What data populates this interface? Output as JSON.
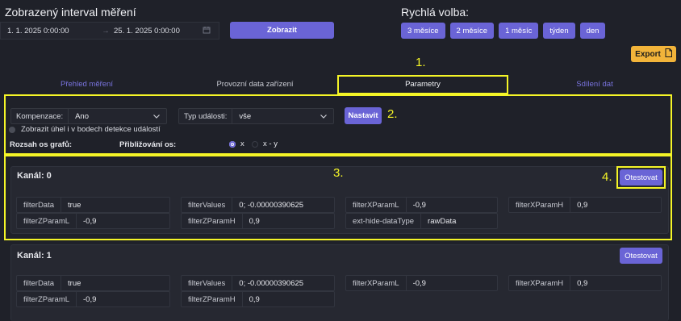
{
  "header": {
    "interval_title": "Zobrazený interval měření",
    "date_from": "1. 1. 2025 0:00:00",
    "date_to": "25. 1. 2025 0:00:00",
    "arrow": "→",
    "show_button": "Zobrazit",
    "quick_title": "Rychlá volba:",
    "quick_options": [
      "3 měsíce",
      "2 měsíce",
      "1 měsíc",
      "týden",
      "den"
    ],
    "export_button": "Export"
  },
  "annotations": {
    "n1": "1.",
    "n2": "2.",
    "n3": "3.",
    "n4": "4."
  },
  "tabs": [
    {
      "label": "Přehled měření",
      "active": false
    },
    {
      "label": "Provozní data zařízení",
      "active": false
    },
    {
      "label": "Parametry",
      "active": true
    },
    {
      "label": "Sdílení dat",
      "active": false
    }
  ],
  "filters": {
    "compensation_label": "Kompenzace:",
    "compensation_value": "Ano",
    "event_type_label": "Typ události:",
    "event_type_value": "vše",
    "set_button": "Nastavit",
    "show_angle_label": "Zobrazit úhel i v bodech detekce událostí",
    "axis_range_label": "Rozsah os grafů:",
    "axis_zoom_label": "Přibližování os:",
    "zoom_options": [
      "x",
      "x - y"
    ],
    "zoom_selected": "x"
  },
  "channels": [
    {
      "title": "Kanál: 0",
      "test_button": "Otestovat",
      "params": [
        {
          "key": "filterData",
          "value": "true"
        },
        {
          "key": "filterValues",
          "value": "0; -0.00000390625"
        },
        {
          "key": "filterXParamL",
          "value": "-0,9"
        },
        {
          "key": "filterXParamH",
          "value": "0,9"
        },
        {
          "key": "filterZParamL",
          "value": "-0,9"
        },
        {
          "key": "filterZParamH",
          "value": "0,9"
        },
        {
          "key": "ext-hide-dataType",
          "value": "rawData"
        }
      ]
    },
    {
      "title": "Kanál: 1",
      "test_button": "Otestovat",
      "params": [
        {
          "key": "filterData",
          "value": "true"
        },
        {
          "key": "filterValues",
          "value": "0; -0.00000390625"
        },
        {
          "key": "filterXParamL",
          "value": "-0,9"
        },
        {
          "key": "filterXParamH",
          "value": "0,9"
        },
        {
          "key": "filterZParamL",
          "value": "-0,9"
        },
        {
          "key": "filterZParamH",
          "value": "0,9"
        }
      ]
    }
  ],
  "colors": {
    "accent": "#6a64d6",
    "export": "#f2b43a",
    "highlight": "#f5f527",
    "background": "#1f2129"
  }
}
